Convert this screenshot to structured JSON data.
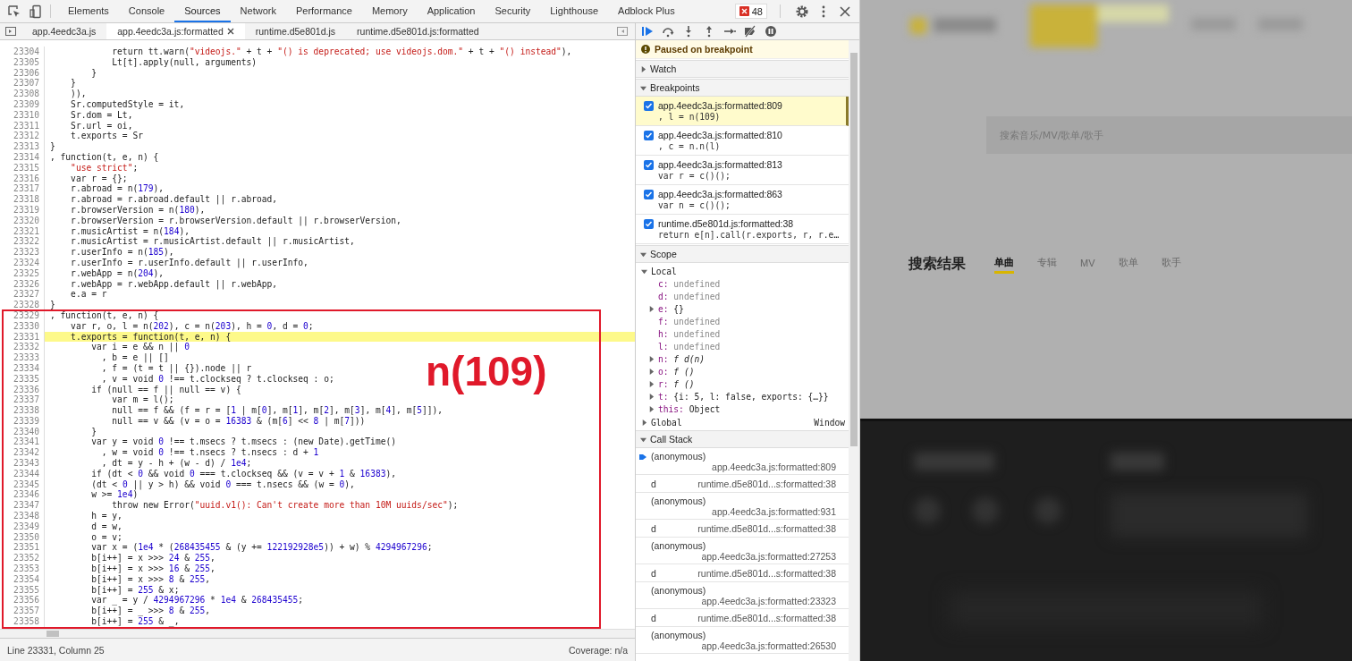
{
  "devtools": {
    "tabs": [
      {
        "label": "Elements",
        "selected": false
      },
      {
        "label": "Console",
        "selected": false
      },
      {
        "label": "Sources",
        "selected": true
      },
      {
        "label": "Network",
        "selected": false
      },
      {
        "label": "Performance",
        "selected": false
      },
      {
        "label": "Memory",
        "selected": false
      },
      {
        "label": "Application",
        "selected": false
      },
      {
        "label": "Security",
        "selected": false
      },
      {
        "label": "Lighthouse",
        "selected": false
      },
      {
        "label": "Adblock Plus",
        "selected": false
      }
    ],
    "error_count": "48",
    "file_tabs": [
      {
        "label": "app.4eedc3a.js",
        "selected": false
      },
      {
        "label": "app.4eedc3a.js:formatted",
        "selected": true
      },
      {
        "label": "runtime.d5e801d.js",
        "selected": false
      },
      {
        "label": "runtime.d5e801d.js:formatted",
        "selected": false
      }
    ],
    "code": {
      "lines": [
        {
          "n": "23304",
          "code": "            return tt.warn(\"videojs.\" + t + \"() is deprecated; use videojs.dom.\" + t + \"() instead\"),",
          "paused": false
        },
        {
          "n": "23305",
          "code": "            Lt[t].apply(null, arguments)",
          "paused": false
        },
        {
          "n": "23306",
          "code": "        }",
          "paused": false
        },
        {
          "n": "23307",
          "code": "    }",
          "paused": false
        },
        {
          "n": "23308",
          "code": "    )),",
          "paused": false
        },
        {
          "n": "23309",
          "code": "    Sr.computedStyle = it,",
          "paused": false
        },
        {
          "n": "23310",
          "code": "    Sr.dom = Lt,",
          "paused": false
        },
        {
          "n": "23311",
          "code": "    Sr.url = oi,",
          "paused": false
        },
        {
          "n": "23312",
          "code": "    t.exports = Sr",
          "paused": false
        },
        {
          "n": "23313",
          "code": "}",
          "paused": false
        },
        {
          "n": "23314",
          "code": ", function(t, e, n) {",
          "paused": false
        },
        {
          "n": "23315",
          "code": "    \"use strict\";",
          "paused": false
        },
        {
          "n": "23316",
          "code": "    var r = {};",
          "paused": false
        },
        {
          "n": "23317",
          "code": "    r.abroad = n(179),",
          "paused": false
        },
        {
          "n": "23318",
          "code": "    r.abroad = r.abroad.default || r.abroad,",
          "paused": false
        },
        {
          "n": "23319",
          "code": "    r.browserVersion = n(180),",
          "paused": false
        },
        {
          "n": "23320",
          "code": "    r.browserVersion = r.browserVersion.default || r.browserVersion,",
          "paused": false
        },
        {
          "n": "23321",
          "code": "    r.musicArtist = n(184),",
          "paused": false
        },
        {
          "n": "23322",
          "code": "    r.musicArtist = r.musicArtist.default || r.musicArtist,",
          "paused": false
        },
        {
          "n": "23323",
          "code": "    r.userInfo = n(185),",
          "paused": false
        },
        {
          "n": "23324",
          "code": "    r.userInfo = r.userInfo.default || r.userInfo,",
          "paused": false
        },
        {
          "n": "23325",
          "code": "    r.webApp = n(204),",
          "paused": false
        },
        {
          "n": "23326",
          "code": "    r.webApp = r.webApp.default || r.webApp,",
          "paused": false
        },
        {
          "n": "23327",
          "code": "    e.a = r",
          "paused": false
        },
        {
          "n": "23328",
          "code": "}",
          "paused": false
        }
      ],
      "annotation": {
        "label": "n(109)",
        "lines": [
          {
            "n": "23329",
            "code": ", function(t, e, n) {",
            "paused": false
          },
          {
            "n": "23330",
            "code": "    var r, o, l = n(202), c = n(203), h = 0, d = 0;",
            "paused": false
          },
          {
            "n": "23331",
            "code": "    t.exports = function(t, e, n) {",
            "paused": true
          },
          {
            "n": "23332",
            "code": "        var i = e && n || 0",
            "paused": false
          },
          {
            "n": "23333",
            "code": "          , b = e || []",
            "paused": false
          },
          {
            "n": "23334",
            "code": "          , f = (t = t || {}).node || r",
            "paused": false
          },
          {
            "n": "23335",
            "code": "          , v = void 0 !== t.clockseq ? t.clockseq : o;",
            "paused": false
          },
          {
            "n": "23336",
            "code": "        if (null == f || null == v) {",
            "paused": false
          },
          {
            "n": "23337",
            "code": "            var m = l();",
            "paused": false
          },
          {
            "n": "23338",
            "code": "            null == f && (f = r = [1 | m[0], m[1], m[2], m[3], m[4], m[5]]),",
            "paused": false
          },
          {
            "n": "23339",
            "code": "            null == v && (v = o = 16383 & (m[6] << 8 | m[7]))",
            "paused": false
          },
          {
            "n": "23340",
            "code": "        }",
            "paused": false
          },
          {
            "n": "23341",
            "code": "        var y = void 0 !== t.msecs ? t.msecs : (new Date).getTime()",
            "paused": false
          },
          {
            "n": "23342",
            "code": "          , w = void 0 !== t.nsecs ? t.nsecs : d + 1",
            "paused": false
          },
          {
            "n": "23343",
            "code": "          , dt = y - h + (w - d) / 1e4;",
            "paused": false
          },
          {
            "n": "23344",
            "code": "        if (dt < 0 && void 0 === t.clockseq && (v = v + 1 & 16383),",
            "paused": false
          },
          {
            "n": "23345",
            "code": "        (dt < 0 || y > h) && void 0 === t.nsecs && (w = 0),",
            "paused": false
          },
          {
            "n": "23346",
            "code": "        w >= 1e4)",
            "paused": false
          },
          {
            "n": "23347",
            "code": "            throw new Error(\"uuid.v1(): Can't create more than 10M uuids/sec\");",
            "paused": false
          },
          {
            "n": "23348",
            "code": "        h = y,",
            "paused": false
          },
          {
            "n": "23349",
            "code": "        d = w,",
            "paused": false
          },
          {
            "n": "23350",
            "code": "        o = v;",
            "paused": false
          },
          {
            "n": "23351",
            "code": "        var x = (1e4 * (268435455 & (y += 122192928e5)) + w) % 4294967296;",
            "paused": false
          },
          {
            "n": "23352",
            "code": "        b[i++] = x >>> 24 & 255,",
            "paused": false
          },
          {
            "n": "23353",
            "code": "        b[i++] = x >>> 16 & 255,",
            "paused": false
          },
          {
            "n": "23354",
            "code": "        b[i++] = x >>> 8 & 255,",
            "paused": false
          },
          {
            "n": "23355",
            "code": "        b[i++] = 255 & x;",
            "paused": false
          },
          {
            "n": "23356",
            "code": "        var _ = y / 4294967296 * 1e4 & 268435455;",
            "paused": false
          },
          {
            "n": "23357",
            "code": "        b[i++] = _ >>> 8 & 255,",
            "paused": false
          },
          {
            "n": "23358",
            "code": "        b[i++] = 255 & _,",
            "paused": false
          }
        ]
      }
    },
    "status_bar": {
      "position": "Line 23331, Column 25",
      "coverage": "Coverage: n/a"
    },
    "debugger": {
      "paused_message": "Paused on breakpoint",
      "watch": {
        "title": "Watch",
        "expanded": false
      },
      "breakpoints": {
        "title": "Breakpoints",
        "expanded": true,
        "items": [
          {
            "location": "app.4eedc3a.js:formatted:809",
            "code": ", l = n(109)",
            "checked": true,
            "selected": true
          },
          {
            "location": "app.4eedc3a.js:formatted:810",
            "code": ", c = n.n(l)",
            "checked": true,
            "selected": false
          },
          {
            "location": "app.4eedc3a.js:formatted:813",
            "code": "var r = c()();",
            "checked": true,
            "selected": false
          },
          {
            "location": "app.4eedc3a.js:formatted:863",
            "code": "var n = c()();",
            "checked": true,
            "selected": false
          },
          {
            "location": "runtime.d5e801d.js:formatted:38",
            "code": "return e[n].call(r.exports, r, r.e…",
            "checked": true,
            "selected": false
          }
        ]
      },
      "scope": {
        "title": "Scope",
        "expanded": true,
        "local": {
          "title": "Local",
          "expanded": true,
          "items": [
            {
              "name": "c:",
              "value": "undefined",
              "kind": "undefined",
              "expandable": false
            },
            {
              "name": "d:",
              "value": "undefined",
              "kind": "undefined",
              "expandable": false
            },
            {
              "name": "e:",
              "value": "{}",
              "kind": "object",
              "expandable": true
            },
            {
              "name": "f:",
              "value": "undefined",
              "kind": "undefined",
              "expandable": false
            },
            {
              "name": "h:",
              "value": "undefined",
              "kind": "undefined",
              "expandable": false
            },
            {
              "name": "l:",
              "value": "undefined",
              "kind": "undefined",
              "expandable": false
            },
            {
              "name": "n:",
              "value": "f d(n)",
              "kind": "function",
              "expandable": true
            },
            {
              "name": "o:",
              "value": "f ()",
              "kind": "function",
              "expandable": true
            },
            {
              "name": "r:",
              "value": "f ()",
              "kind": "function",
              "expandable": true
            },
            {
              "name": "t:",
              "value": "{i: 5, l: false, exports: {…}}",
              "kind": "object",
              "expandable": true
            },
            {
              "name": "this:",
              "value": "Object",
              "kind": "object",
              "expandable": true
            }
          ]
        },
        "global": {
          "title": "Global",
          "value": "Window",
          "expanded": false
        }
      },
      "call_stack": {
        "title": "Call Stack",
        "expanded": true,
        "frames": [
          {
            "function": "(anonymous)",
            "location": "app.4eedc3a.js:formatted:809",
            "current": true,
            "kind": "stacked"
          },
          {
            "function": "d",
            "location": "runtime.d5e801d...s:formatted:38",
            "current": false,
            "kind": "inline"
          },
          {
            "function": "(anonymous)",
            "location": "app.4eedc3a.js:formatted:931",
            "current": false,
            "kind": "stacked"
          },
          {
            "function": "d",
            "location": "runtime.d5e801d...s:formatted:38",
            "current": false,
            "kind": "inline"
          },
          {
            "function": "(anonymous)",
            "location": "app.4eedc3a.js:formatted:27253",
            "current": false,
            "kind": "stacked"
          },
          {
            "function": "d",
            "location": "runtime.d5e801d...s:formatted:38",
            "current": false,
            "kind": "inline"
          },
          {
            "function": "(anonymous)",
            "location": "app.4eedc3a.js:formatted:23323",
            "current": false,
            "kind": "stacked"
          },
          {
            "function": "d",
            "location": "runtime.d5e801d...s:formatted:38",
            "current": false,
            "kind": "inline"
          },
          {
            "function": "(anonymous)",
            "location": "app.4eedc3a.js:formatted:26530",
            "current": false,
            "kind": "stacked"
          }
        ]
      }
    }
  },
  "page": {
    "search_placeholder": "搜索音乐/MV/歌单/歌手",
    "results_title": "搜索结果",
    "tabs": [
      {
        "label": "单曲",
        "selected": true
      },
      {
        "label": "专辑",
        "selected": false
      },
      {
        "label": "MV",
        "selected": false
      },
      {
        "label": "歌单",
        "selected": false
      },
      {
        "label": "歌手",
        "selected": false
      }
    ]
  }
}
